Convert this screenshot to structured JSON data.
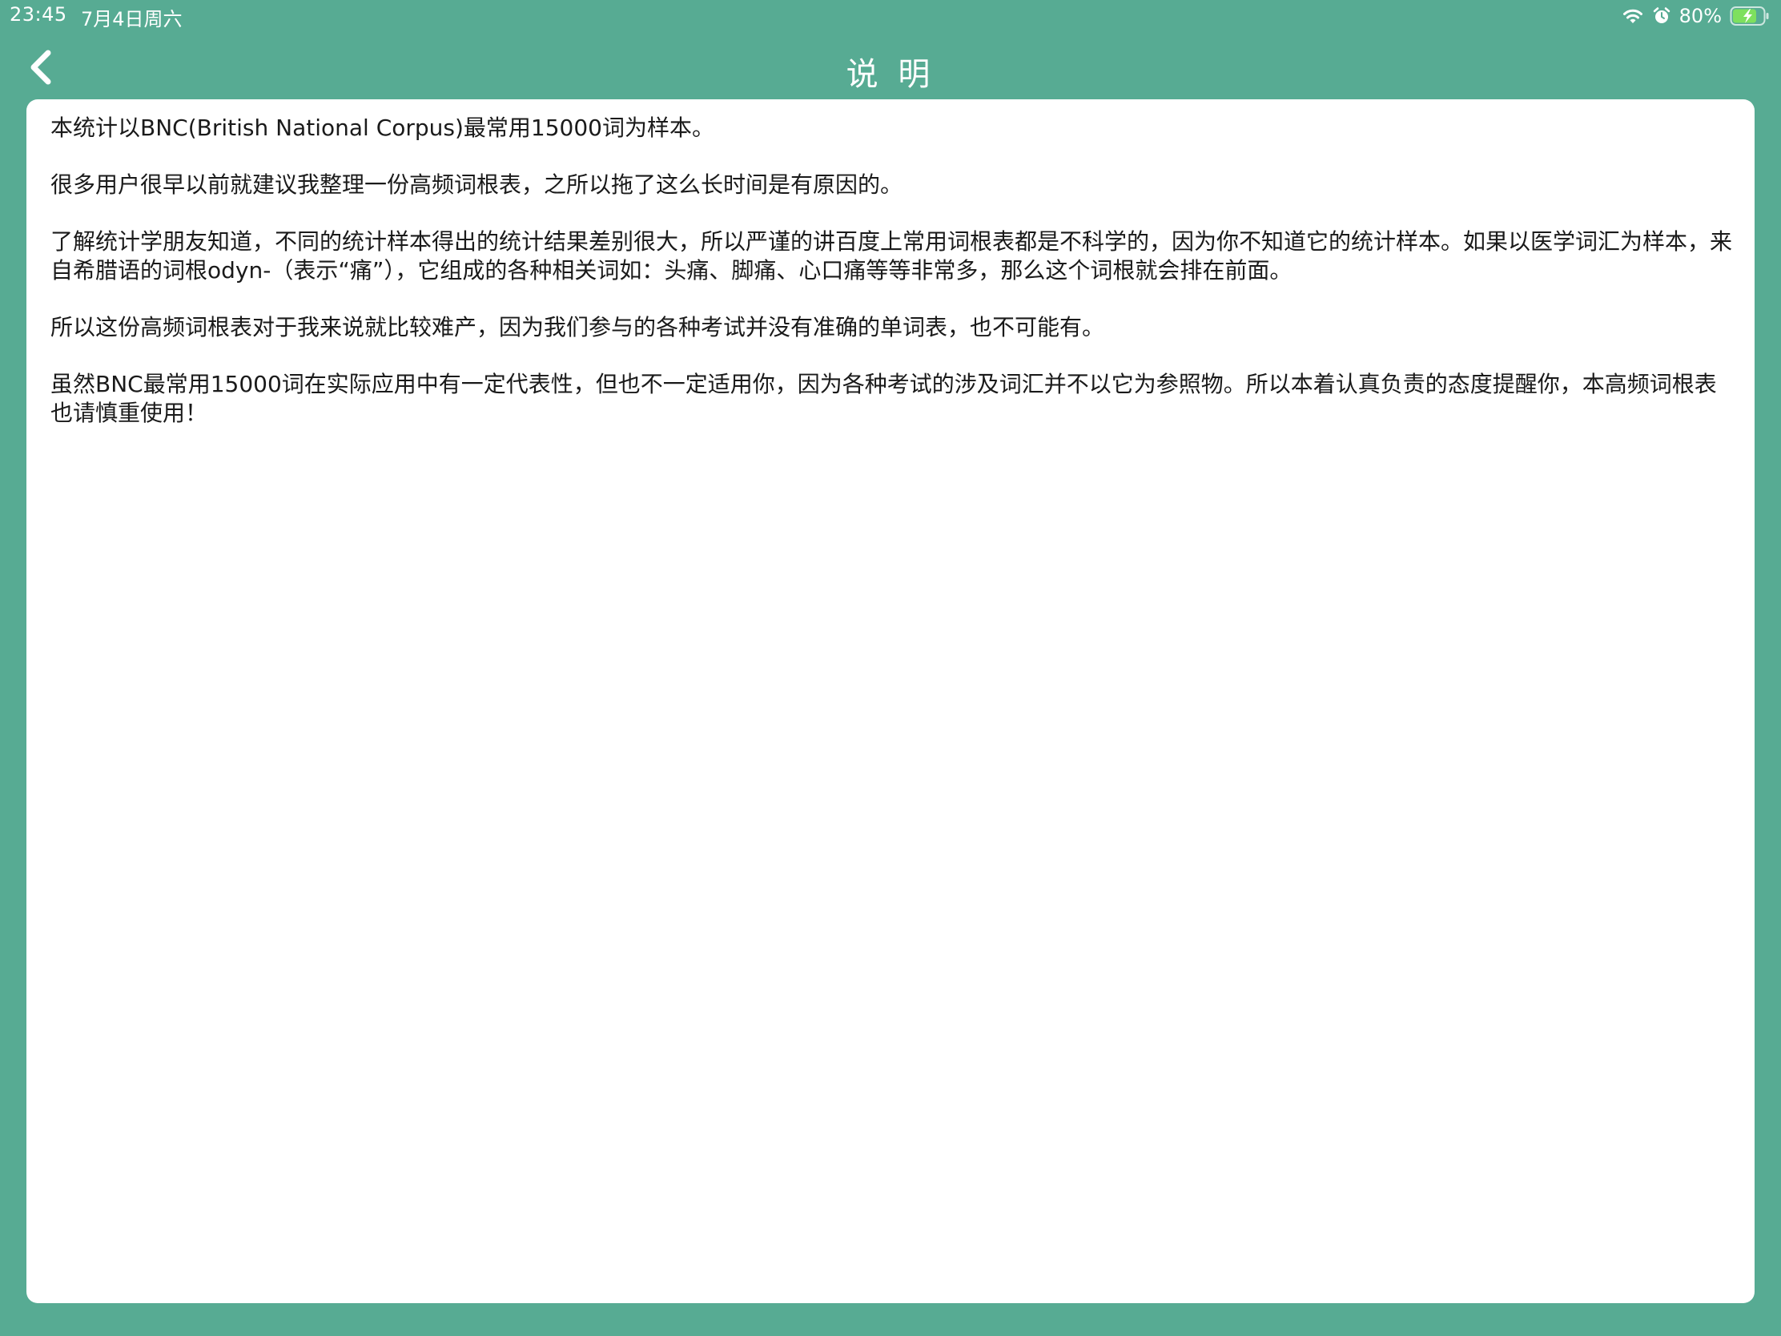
{
  "status_bar": {
    "time": "23:45",
    "date": "7月4日周六",
    "battery": "80%",
    "icons": [
      "wifi-icon",
      "alarm-icon",
      "battery-charging-icon"
    ]
  },
  "nav": {
    "back_icon": "chevron-left-icon",
    "title": "说 明"
  },
  "content": {
    "paragraphs": [
      "本统计以BNC(British National Corpus)最常用15000词为样本。",
      "很多用户很早以前就建议我整理一份高频词根表，之所以拖了这么长时间是有原因的。",
      "了解统计学朋友知道，不同的统计样本得出的统计结果差别很大，所以严谨的讲百度上常用词根表都是不科学的，因为你不知道它的统计样本。如果以医学词汇为样本，来自希腊语的词根odyn-（表示“痛”），它组成的各种相关词如：头痛、脚痛、心口痛等等非常多，那么这个词根就会排在前面。",
      "所以这份高频词根表对于我来说就比较难产，因为我们参与的各种考试并没有准确的单词表，也不可能有。",
      "虽然BNC最常用15000词在实际应用中有一定代表性，但也不一定适用你，因为各种考试的涉及词汇并不以它为参照物。所以本着认真负责的态度提醒你，本高频词根表也请慎重使用！"
    ]
  },
  "colors": {
    "background": "#57ab93",
    "card": "#ffffff",
    "text": "#1a1a1a",
    "header_text": "#ffffff"
  }
}
